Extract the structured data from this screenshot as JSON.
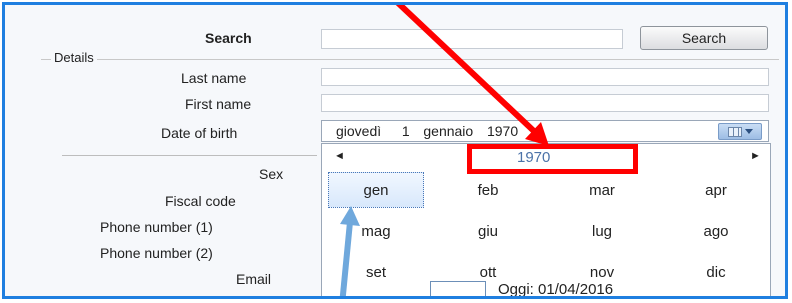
{
  "search": {
    "label": "Search",
    "button_label": "Search",
    "value": ""
  },
  "details": {
    "group_label": "Details",
    "last_name": "Last name",
    "first_name": "First name",
    "date_of_birth": "Date of birth",
    "sex": "Sex",
    "fiscal_code": "Fiscal code",
    "phone1": "Phone number (1)",
    "phone2": "Phone number (2)",
    "email": "Email"
  },
  "date_picker": {
    "value": "giovedì   1  gennaio  1970"
  },
  "calendar": {
    "prev": "◄",
    "next": "►",
    "year": "1970",
    "months": [
      "gen",
      "feb",
      "mar",
      "apr",
      "mag",
      "giu",
      "lug",
      "ago",
      "set",
      "ott",
      "nov",
      "dic"
    ],
    "selected_month": "gen",
    "today_label": "Oggi: 01/04/2016"
  },
  "colors": {
    "accent": "#1f7fe0",
    "highlight_box": "#ff0000",
    "pointer_arrow": "#6fa8dc"
  },
  "icons": {
    "calendar_dropdown": "calendar-grid-icon"
  }
}
